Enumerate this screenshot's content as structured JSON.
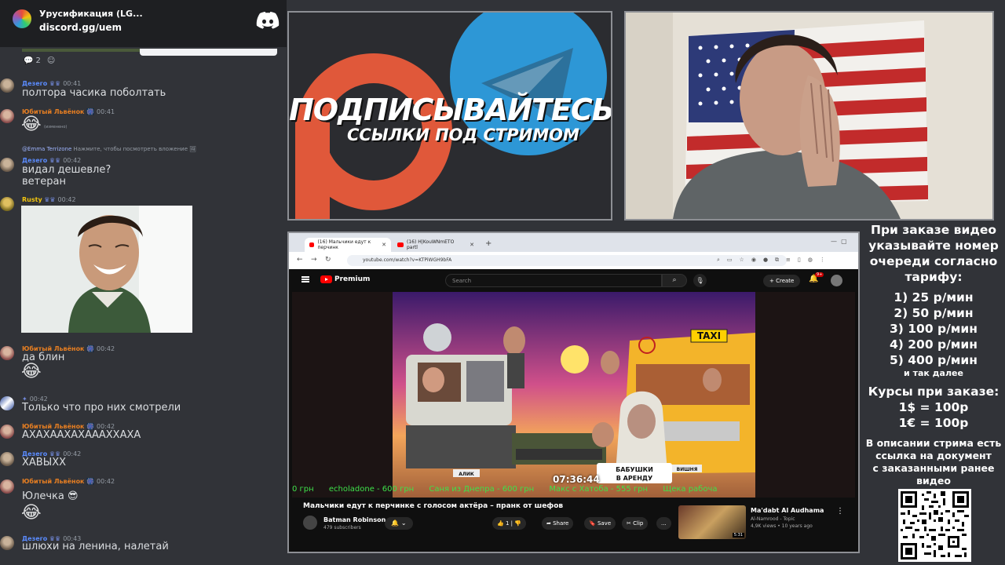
{
  "colors": {
    "discord_bg": "#313338",
    "ticker_green": "#3ee04a",
    "youtube_red": "#ff0000"
  },
  "chat": {
    "server_name": "Урусификация (LG...",
    "invite": "discord.gg/uem",
    "reactions": {
      "count": "2"
    },
    "messages": [
      {
        "user": "Дезего",
        "time": "00:41",
        "text": "полтора часика поболтать"
      },
      {
        "user": "Юбитый Львёнок",
        "time": "00:41",
        "emoji": "😂",
        "note": "(изменено)"
      },
      {
        "reply": {
          "mention": "@Emma Terrizone",
          "text": "Нажмите, чтобы посмотреть вложение"
        },
        "user": "Дезего",
        "time": "00:42",
        "text1": "видал дешевле?",
        "text2": "ветеран"
      },
      {
        "user": "Rusty",
        "time": "00:42"
      },
      {
        "user": "Юбитый Львёнок",
        "time": "00:42",
        "text": "да блин",
        "emoji": "😂"
      },
      {
        "user": "",
        "time": "00:42",
        "text": "Только что про них смотрели"
      },
      {
        "user": "Юбитый Львёнок",
        "time": "00:42",
        "text": "АХАХААХАХАААХХАХА"
      },
      {
        "user": "Дезего",
        "time": "00:42",
        "text": "ХАВЫХХ"
      },
      {
        "user": "Юбитый Львёнок",
        "time": "00:42",
        "text": "Юлечка",
        "emoji_inline": "😎",
        "emoji": "😂"
      },
      {
        "user": "Дезего",
        "time": "00:43",
        "text": "шлюхи на ленина, налетай"
      }
    ]
  },
  "promo": {
    "title": "ПОДПИСЫВАЙТЕСЬ",
    "subtitle": "ССЫЛКИ ПОД СТРИМОМ"
  },
  "browser": {
    "tabs": [
      "(16) Мальчики едут к перчинк",
      "(16) H|KouWNmETO partl"
    ],
    "url": "youtube.com/watch?v=KTPiWGH9bFA",
    "youtube": {
      "logo": "Premium",
      "search_placeholder": "Search",
      "create": "Create",
      "notifications": "9+",
      "timecode": "07:36:44",
      "ticker": [
        "0 грн",
        "echoladone - 600 грн",
        "Саня из Днепра - 600 грн",
        "Макс с Хатоба - 555 грн",
        "Щека рабоча"
      ],
      "video_title": "Мальчики едут к перчинке с голосом актёра – пранк от шефов",
      "channel_name": "Batman Robinson",
      "channel_subs": "479 subscribers",
      "likes": "1",
      "share": "Share",
      "save": "Save",
      "clip": "Clip",
      "more": "...",
      "rec_title": "Ma'dabt Al Audhama",
      "rec_channel": "Al-Namrood - Topic",
      "rec_stats": "4,9K views • 10 years ago",
      "rec_duration": "5:31"
    },
    "thumbnail_text": {
      "taxi": "TAXI",
      "babushki": "БАБУШКИ В АРЕНДУ",
      "alik": "АЛИК",
      "vishnya": "ВИШНЯ"
    }
  },
  "info": {
    "heading_lines": [
      "При заказе видео",
      "указывайте номер",
      "очереди согласно",
      "тарифу:"
    ],
    "tariffs": [
      "1) 25 р/мин",
      "2) 50 р/мин",
      "3) 100 р/мин",
      "4) 200 р/мин",
      "5) 400 р/мин"
    ],
    "etc": "и так далее",
    "rates_title": "Курсы при заказе:",
    "rates": [
      "1$ = 100р",
      "1€ = 100р"
    ],
    "desc_lines": [
      "В описании стрима есть",
      "ссылка на документ",
      "с заказанными ранее",
      "видео"
    ]
  }
}
